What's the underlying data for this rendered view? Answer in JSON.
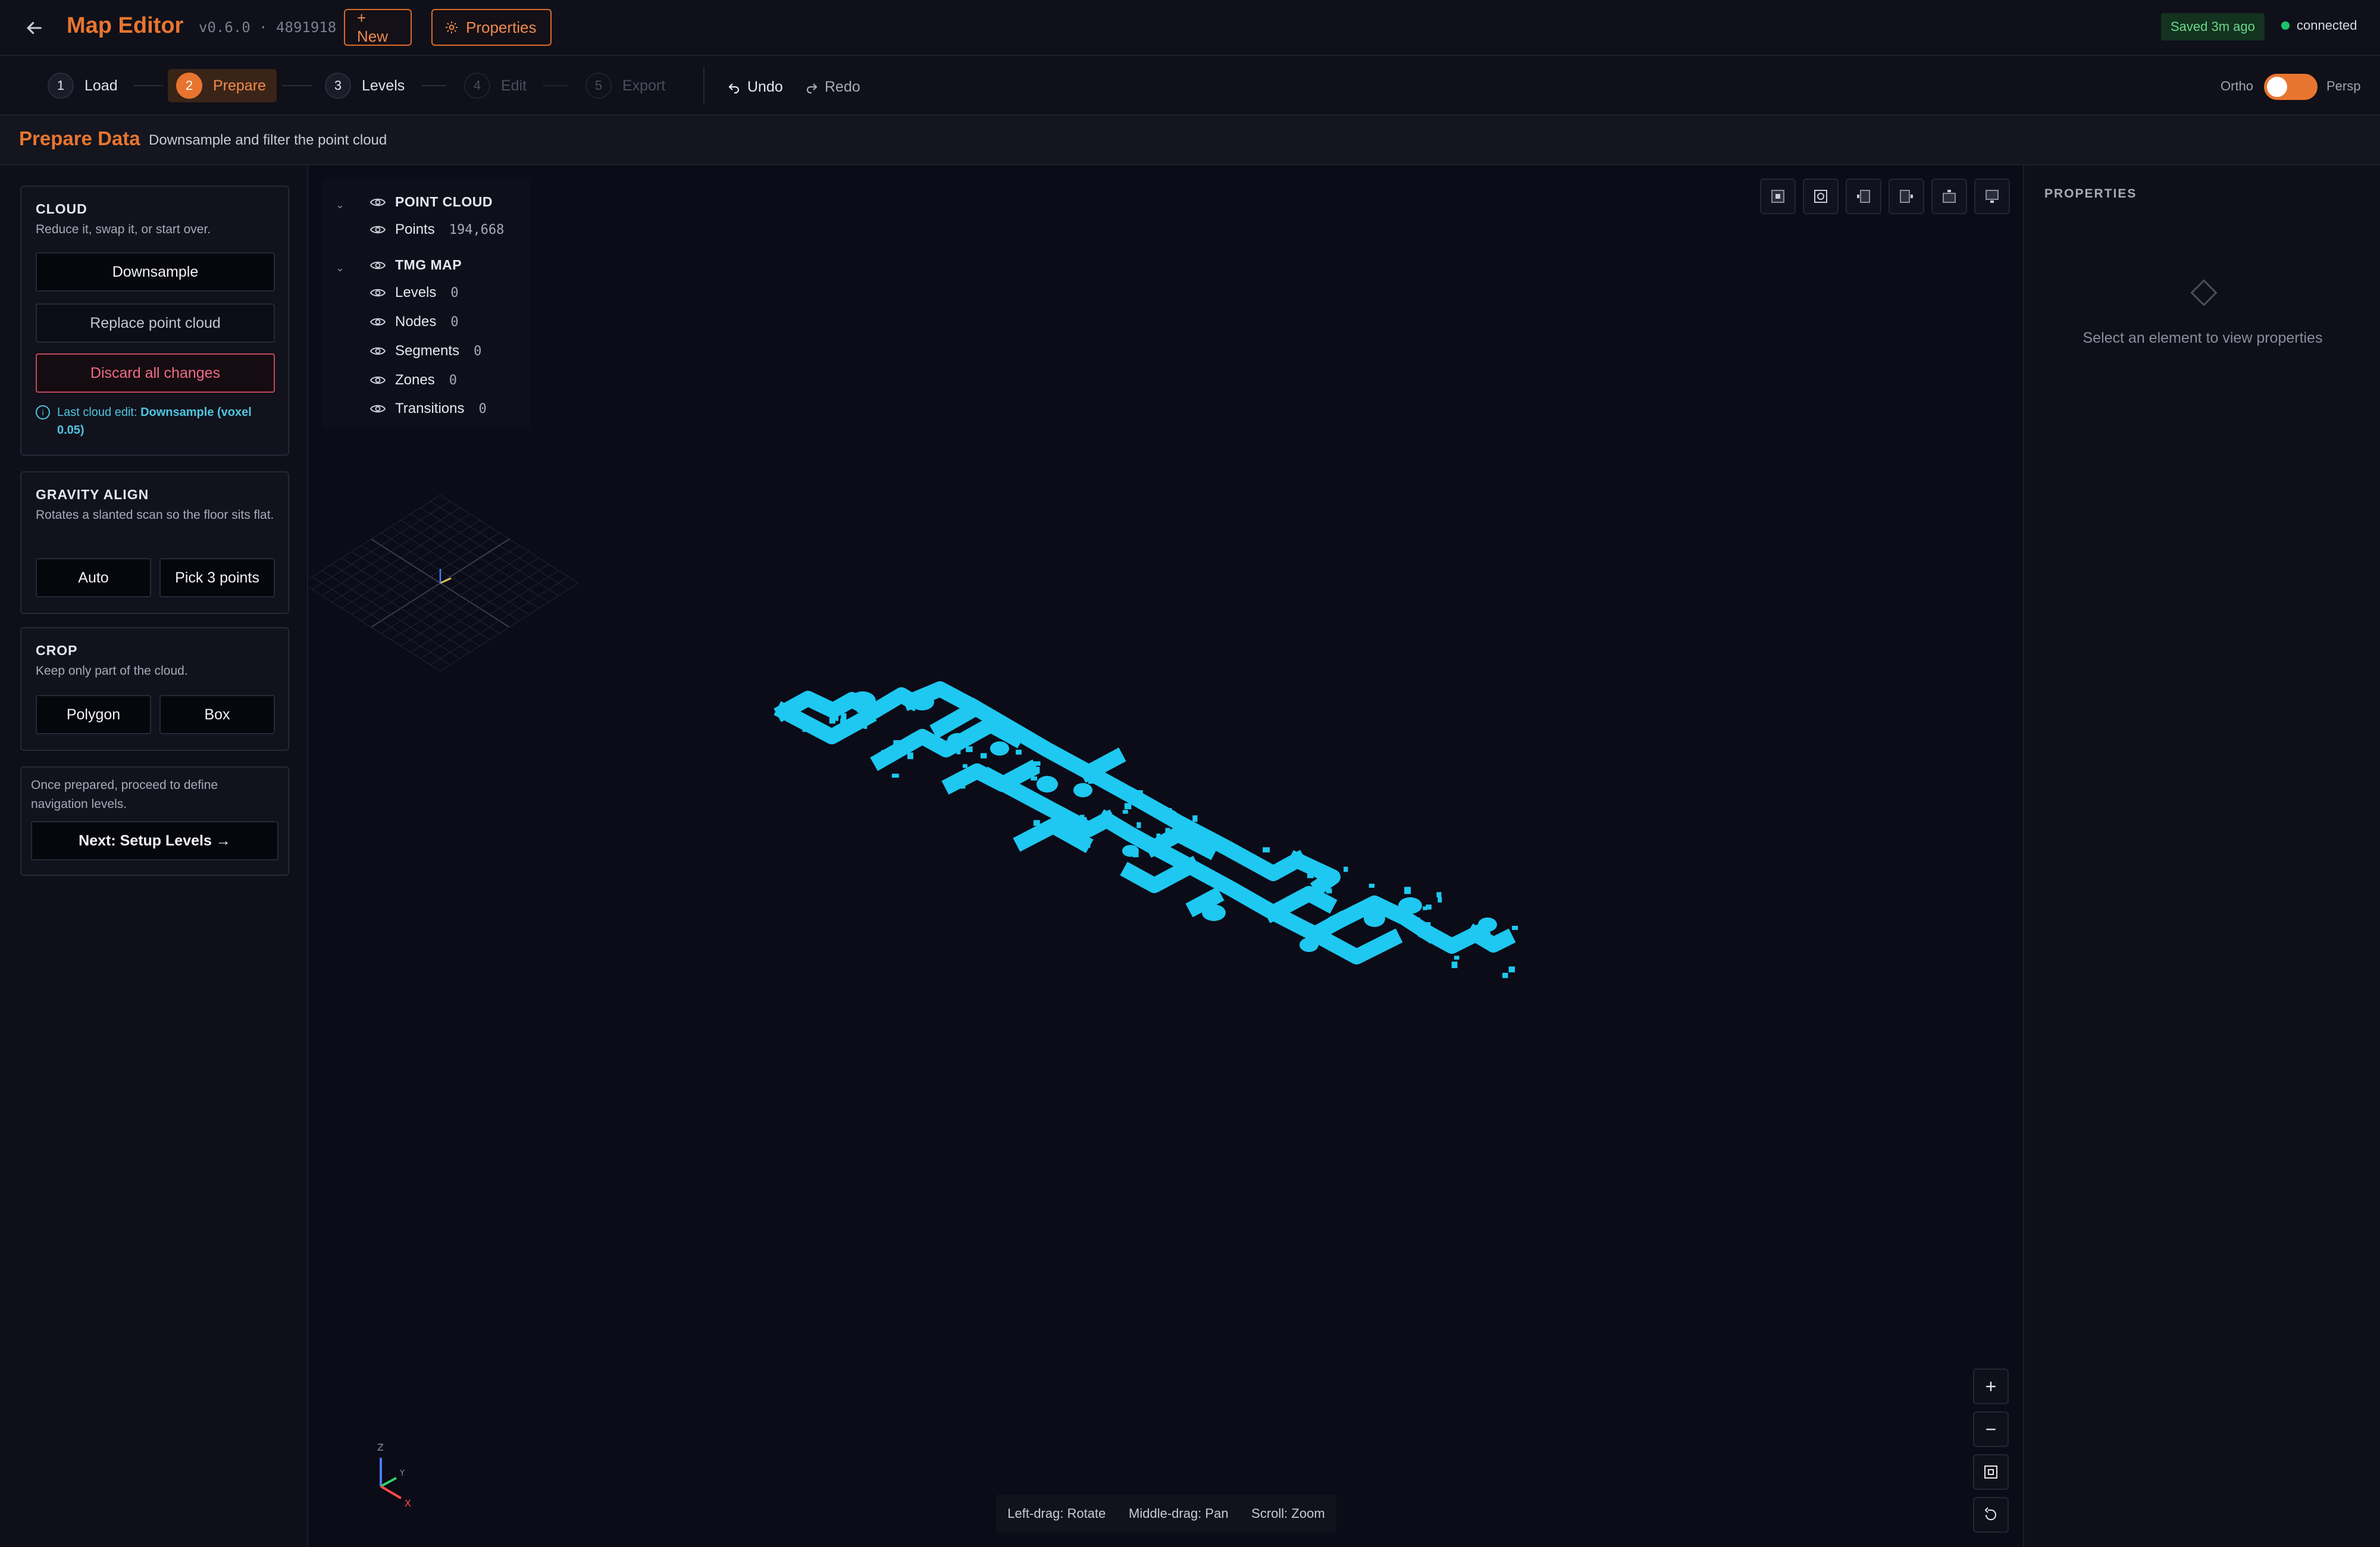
{
  "header": {
    "title": "Map Editor",
    "version": "v0.6.0 · 4891918",
    "new_label": "+ New",
    "properties_label": "Properties",
    "saved_label": "Saved 3m ago",
    "connection_label": "connected"
  },
  "steps": [
    {
      "num": "1",
      "label": "Load",
      "state": "done"
    },
    {
      "num": "2",
      "label": "Prepare",
      "state": "active"
    },
    {
      "num": "3",
      "label": "Levels",
      "state": "done"
    },
    {
      "num": "4",
      "label": "Edit",
      "state": "disabled"
    },
    {
      "num": "5",
      "label": "Export",
      "state": "disabled"
    }
  ],
  "history": {
    "undo_label": "Undo",
    "redo_label": "Redo"
  },
  "view_toggle": {
    "left_label": "Ortho",
    "right_label": "Persp",
    "selected": "Persp"
  },
  "page": {
    "title": "Prepare Data",
    "subtitle": "Downsample and filter the point cloud"
  },
  "cloud": {
    "title": "CLOUD",
    "desc": "Reduce it, swap it, or start over.",
    "downsample": "Downsample",
    "replace": "Replace point cloud",
    "discard": "Discard all changes",
    "info_prefix": "Last cloud edit: ",
    "info_value": "Downsample (voxel 0.05)"
  },
  "gravity": {
    "title": "GRAVITY ALIGN",
    "desc": "Rotates a slanted scan so the floor sits flat.",
    "auto": "Auto",
    "pick": "Pick 3 points"
  },
  "crop": {
    "title": "CROP",
    "desc": "Keep only part of the cloud.",
    "polygon": "Polygon",
    "box": "Box"
  },
  "next": {
    "desc": "Once prepared, proceed to define navigation levels.",
    "button": "Next: Setup Levels →"
  },
  "scene_tree": {
    "point_cloud": {
      "label": "POINT CLOUD",
      "points_label": "Points",
      "points_value": "194,668"
    },
    "tmg_map": {
      "label": "TMG MAP",
      "items": [
        {
          "label": "Levels",
          "value": "0"
        },
        {
          "label": "Nodes",
          "value": "0"
        },
        {
          "label": "Segments",
          "value": "0"
        },
        {
          "label": "Zones",
          "value": "0"
        },
        {
          "label": "Transitions",
          "value": "0"
        }
      ]
    }
  },
  "hint": {
    "rotate": "Left-drag: Rotate",
    "pan": "Middle-drag: Pan",
    "zoom": "Scroll: Zoom"
  },
  "axes": {
    "z": "Z",
    "y": "Y",
    "x": "X"
  },
  "properties_panel": {
    "title": "PROPERTIES",
    "empty": "Select an element to view properties"
  },
  "colors": {
    "accent": "#e8752f",
    "cloud": "#1ec8f0",
    "success": "#1fc16a",
    "danger": "#ef6c85"
  }
}
